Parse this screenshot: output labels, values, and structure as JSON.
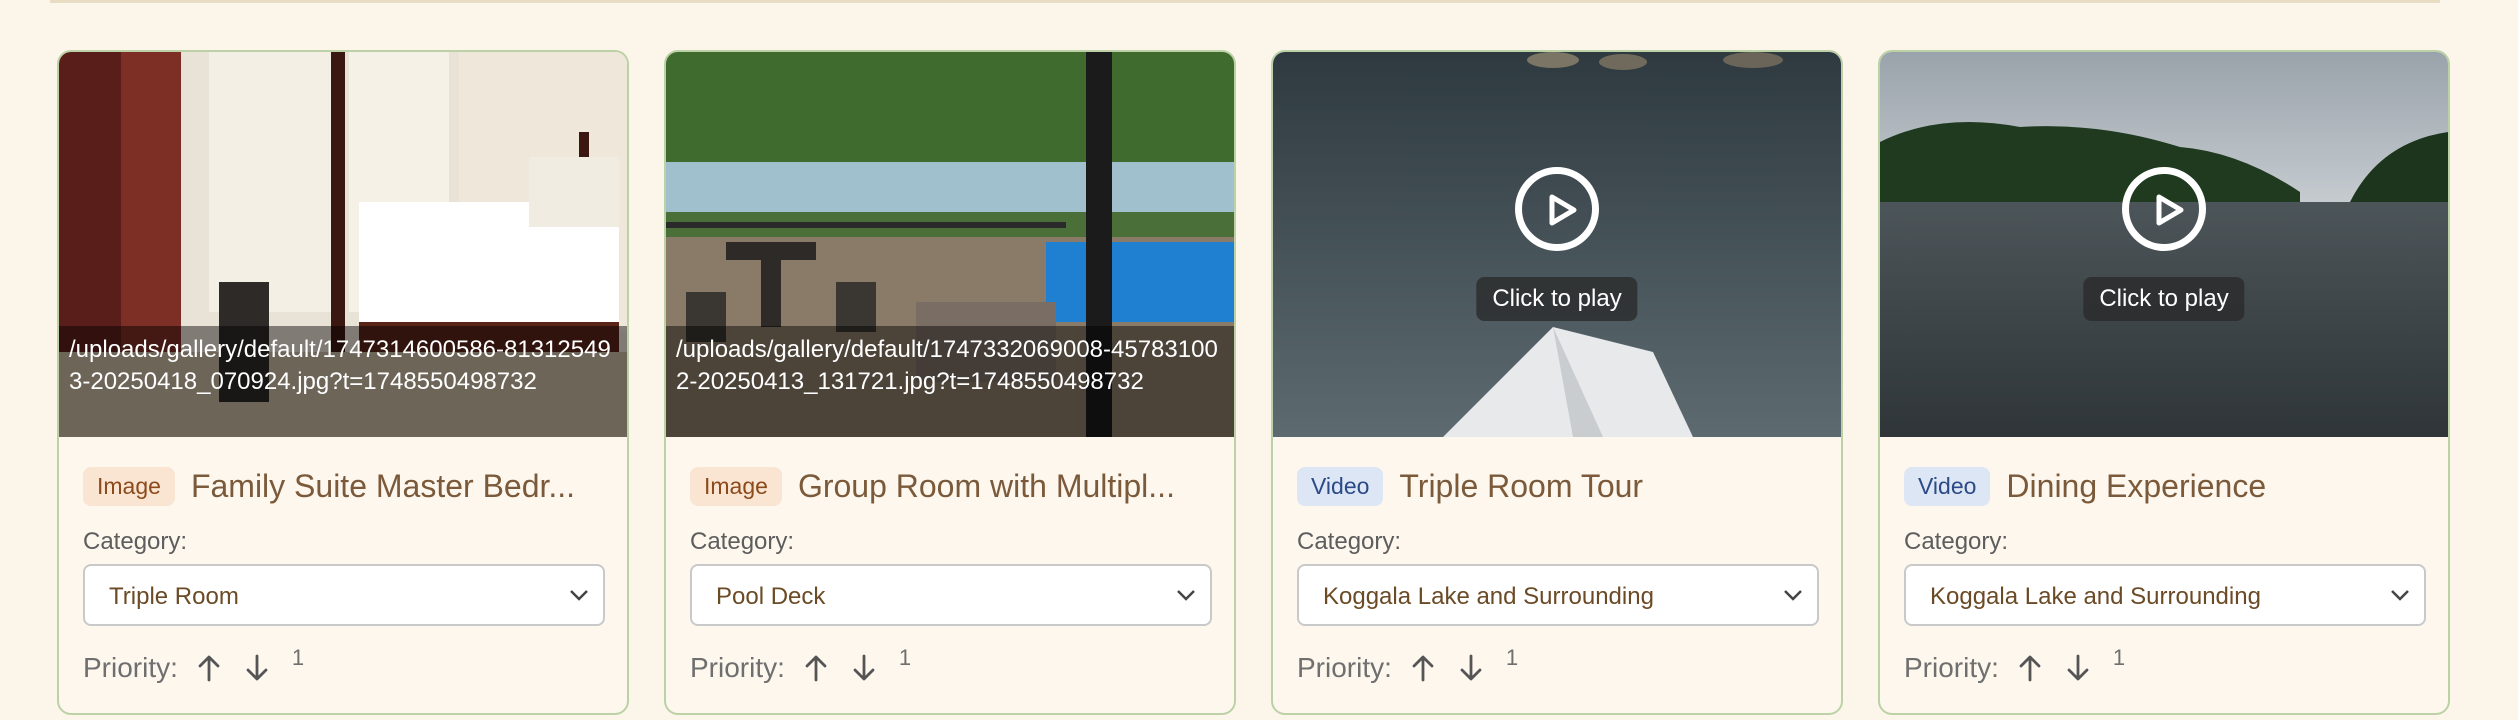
{
  "cards": [
    {
      "type_label": "Image",
      "title": "Family Suite Master Bedr...",
      "path": "/uploads/gallery/default/1747314600586-813125493-20250418_070924.jpg?t=1748550498732",
      "category_label": "Category:",
      "category_value": "Triple Room",
      "priority_label": "Priority:",
      "priority_value": "1"
    },
    {
      "type_label": "Image",
      "title": "Group Room with Multipl...",
      "path": "/uploads/gallery/default/1747332069008-457831002-20250413_131721.jpg?t=1748550498732",
      "category_label": "Category:",
      "category_value": "Pool Deck",
      "priority_label": "Priority:",
      "priority_value": "1"
    },
    {
      "type_label": "Video",
      "title": "Triple Room Tour",
      "play_label": "Click to play",
      "category_label": "Category:",
      "category_value": "Koggala Lake and Surrounding",
      "priority_label": "Priority:",
      "priority_value": "1"
    },
    {
      "type_label": "Video",
      "title": "Dining Experience",
      "play_label": "Click to play",
      "category_label": "Category:",
      "category_value": "Koggala Lake and Surrounding",
      "priority_label": "Priority:",
      "priority_value": "1"
    }
  ],
  "icons": {
    "play": "play-circle-icon",
    "up": "arrow-up-icon",
    "down": "arrow-down-icon",
    "select": "chevron-down-icon"
  },
  "colors": {
    "page_bg": "#fcf6ea",
    "card_border": "#bcd2a6",
    "image_badge_bg": "#fae5d3",
    "video_badge_bg": "#dde6f5",
    "title_text": "#7a5a3a"
  }
}
